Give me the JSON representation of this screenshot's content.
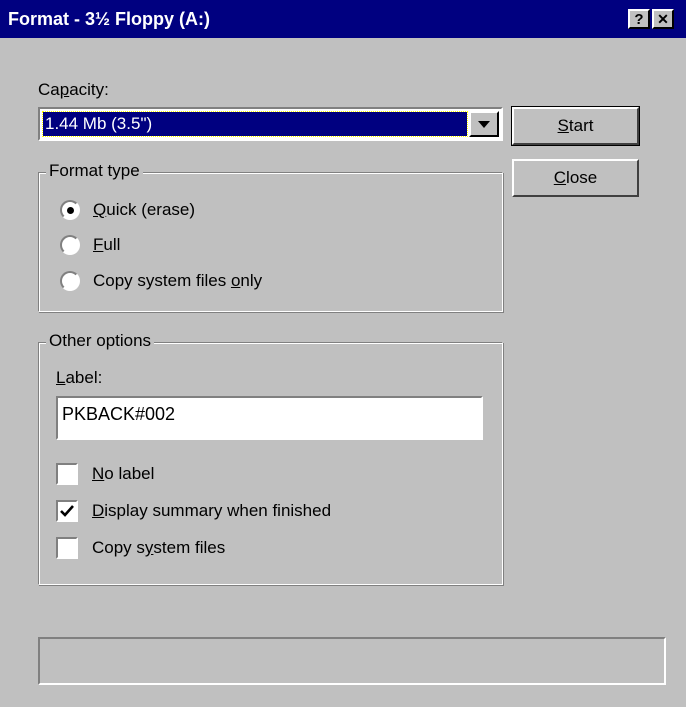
{
  "window": {
    "title": "Format - 3½ Floppy (A:)",
    "help_label": "?",
    "close_label": "✕"
  },
  "capacity": {
    "label_pre": "Ca",
    "label_ul": "p",
    "label_post": "acity:",
    "value": "1.44 Mb (3.5\")"
  },
  "buttons": {
    "start_ul": "S",
    "start_rest": "tart",
    "close_ul": "C",
    "close_rest": "lose"
  },
  "format_type": {
    "legend": "Format type",
    "options": [
      {
        "pre": "",
        "ul": "Q",
        "post": "uick (erase)",
        "selected": true
      },
      {
        "pre": "",
        "ul": "F",
        "post": "ull",
        "selected": false
      },
      {
        "pre": "Copy system files ",
        "ul": "o",
        "post": "nly",
        "selected": false
      }
    ]
  },
  "other_options": {
    "legend": "Other options",
    "label_ul": "L",
    "label_rest": "abel:",
    "label_value": "PKBACK#002",
    "checkboxes": [
      {
        "pre": "",
        "ul": "N",
        "post": "o label",
        "checked": false
      },
      {
        "pre": "",
        "ul": "D",
        "post": "isplay summary when finished",
        "checked": true
      },
      {
        "pre": "Copy s",
        "ul": "y",
        "post": "stem files",
        "checked": false
      }
    ]
  },
  "status": {
    "text": ""
  }
}
